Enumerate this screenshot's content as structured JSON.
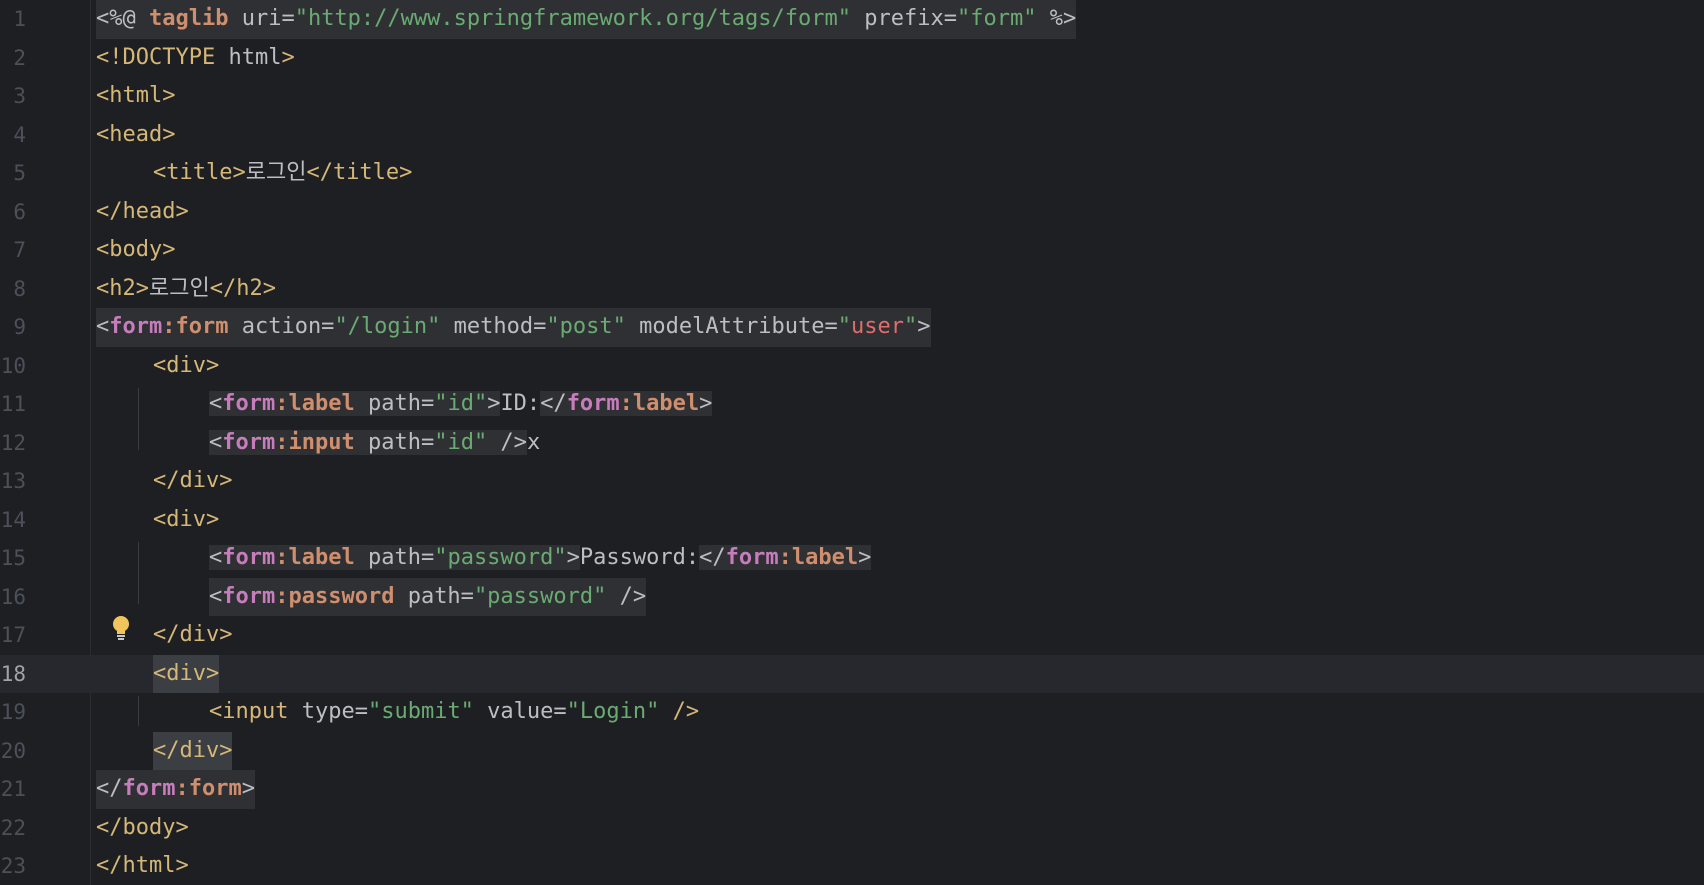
{
  "editor": {
    "language": "JSP",
    "current_line": 18,
    "lines": [
      {
        "n": "1",
        "code": "<%@ taglib uri=\"http://www.springframework.org/tags/form\" prefix=\"form\" %>"
      },
      {
        "n": "2",
        "code": "<!DOCTYPE html>"
      },
      {
        "n": "3",
        "code": "<html>"
      },
      {
        "n": "4",
        "code": "<head>"
      },
      {
        "n": "5",
        "code": "    <title>로그인</title>"
      },
      {
        "n": "6",
        "code": "</head>"
      },
      {
        "n": "7",
        "code": "<body>"
      },
      {
        "n": "8",
        "code": "<h2>로그인</h2>"
      },
      {
        "n": "9",
        "code": "<form:form action=\"/login\" method=\"post\" modelAttribute=\"user\">"
      },
      {
        "n": "10",
        "code": "    <div>"
      },
      {
        "n": "11",
        "code": "        <form:label path=\"id\">ID:</form:label>"
      },
      {
        "n": "12",
        "code": "        <form:input path=\"id\" />x"
      },
      {
        "n": "13",
        "code": "    </div>"
      },
      {
        "n": "14",
        "code": "    <div>"
      },
      {
        "n": "15",
        "code": "        <form:label path=\"password\">Password:</form:label>"
      },
      {
        "n": "16",
        "code": "        <form:password path=\"password\" />"
      },
      {
        "n": "17",
        "code": "    </div>"
      },
      {
        "n": "18",
        "code": "    <div>"
      },
      {
        "n": "19",
        "code": "        <input type=\"submit\" value=\"Login\" />"
      },
      {
        "n": "20",
        "code": "    </div>"
      },
      {
        "n": "21",
        "code": "</form:form>"
      },
      {
        "n": "22",
        "code": "</body>"
      },
      {
        "n": "23",
        "code": "</html>"
      }
    ],
    "gutter_icon": "lightbulb-icon",
    "colors": {
      "background": "#1e1f22",
      "tag": "#d5b778",
      "attribute_value": "#6aab73",
      "namespace": "#c77dbb",
      "keyword": "#cf8e6d",
      "highlight_value": "#e06c6c"
    }
  }
}
